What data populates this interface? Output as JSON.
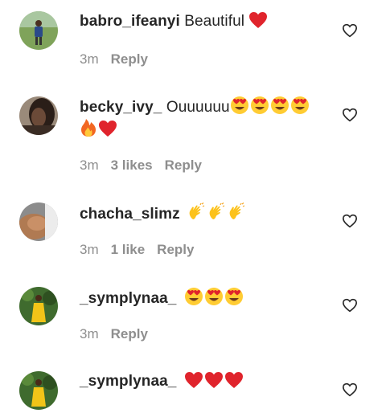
{
  "comments": [
    {
      "username": "babro_ifeanyi",
      "text": "Beautiful",
      "emojis": [
        "red-heart"
      ],
      "time": "3m",
      "likes": "",
      "reply_label": "Reply",
      "avatar": "person-on-field"
    },
    {
      "username": "becky_ivy_",
      "text": "Ouuuuuu",
      "emojis": [
        "heart-eyes",
        "heart-eyes",
        "heart-eyes",
        "heart-eyes"
      ],
      "emojis_line2": [
        "fire",
        "red-heart"
      ],
      "time": "3m",
      "likes": "3 likes",
      "reply_label": "Reply",
      "avatar": "dark-portrait"
    },
    {
      "username": "chacha_slimz",
      "text": "",
      "emojis": [
        "clapping-hands",
        "clapping-hands",
        "clapping-hands"
      ],
      "time": "3m",
      "likes": "1 like",
      "reply_label": "Reply",
      "avatar": "skin-closeup"
    },
    {
      "username": "_symplynaa_",
      "text": "",
      "emojis": [
        "heart-eyes",
        "heart-eyes",
        "heart-eyes"
      ],
      "time": "3m",
      "likes": "",
      "reply_label": "Reply",
      "avatar": "person-yellow-dress"
    },
    {
      "username": "_symplynaa_",
      "text": "",
      "emojis": [
        "red-heart",
        "red-heart",
        "red-heart"
      ],
      "time": "",
      "likes": "",
      "reply_label": "",
      "avatar": "person-yellow-dress"
    }
  ],
  "colors": {
    "text": "#262626",
    "meta": "#8e8e8e",
    "heart": "#e0242c",
    "outline": "#262626"
  }
}
